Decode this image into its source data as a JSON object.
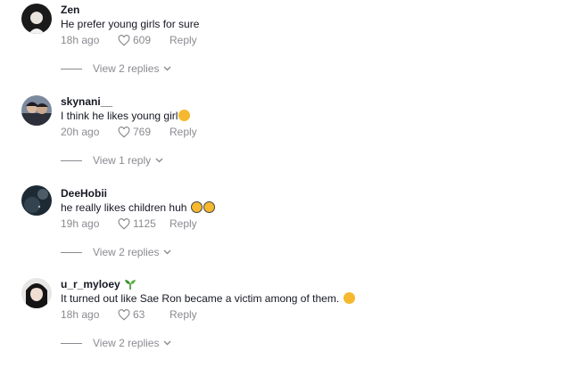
{
  "comments": [
    {
      "username": "Zen",
      "text": "He prefer young girls for sure",
      "time": "18h ago",
      "likes": "609",
      "reply_label": "Reply",
      "replies_label": "View 2 replies"
    },
    {
      "username": "skynani__",
      "text": "I think he likes young girl",
      "time": "20h ago",
      "likes": "769",
      "reply_label": "Reply",
      "replies_label": "View 1 reply"
    },
    {
      "username": "DeeHobii",
      "text": "he really likes children huh",
      "time": "19h ago",
      "likes": "1125",
      "reply_label": "Reply",
      "replies_label": "View 2 replies"
    },
    {
      "username": "u_r_myloey",
      "text": "It turned out like Sae Ron became a victim among of them.",
      "time": "18h ago",
      "likes": "63",
      "reply_label": "Reply",
      "replies_label": "View 2 replies"
    }
  ],
  "icons": {
    "like": "heart-outline-icon",
    "expand": "chevron-down-icon",
    "badge": "sprout-icon"
  },
  "colors": {
    "text": "#161823",
    "muted": "#8a8b91",
    "emoji": "#f5b82e",
    "badge": "#3a8f2f"
  }
}
